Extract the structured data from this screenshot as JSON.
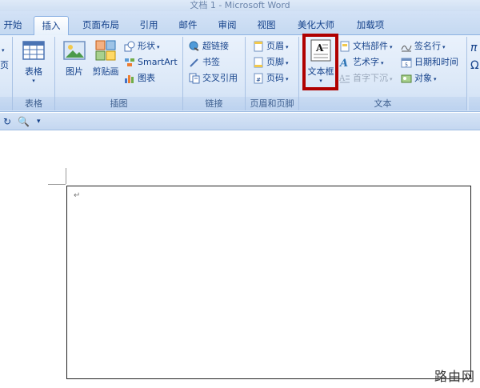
{
  "window": {
    "title": "文档 1 - Microsoft Word"
  },
  "tabs": [
    {
      "label": "开始"
    },
    {
      "label": "插入"
    },
    {
      "label": "页面布局"
    },
    {
      "label": "引用"
    },
    {
      "label": "邮件"
    },
    {
      "label": "审阅"
    },
    {
      "label": "视图"
    },
    {
      "label": "美化大师"
    },
    {
      "label": "加载项"
    }
  ],
  "active_tab": "插入",
  "ribbon": {
    "cut_left": {
      "label": "页"
    },
    "tables": {
      "group_label": "表格",
      "table_button": "表格"
    },
    "illustrations": {
      "group_label": "插图",
      "picture": "图片",
      "clipart": "剪贴画",
      "shapes": "形状",
      "smartart": "SmartArt",
      "chart": "图表"
    },
    "links": {
      "group_label": "链接",
      "hyperlink": "超链接",
      "bookmark": "书签",
      "crossref": "交叉引用"
    },
    "header_footer": {
      "group_label": "页眉和页脚",
      "header": "页眉",
      "footer": "页脚",
      "page_number": "页码"
    },
    "text": {
      "group_label": "文本",
      "textbox": "文本框",
      "quickparts": "文档部件",
      "wordart": "艺术字",
      "dropcap": "首字下沉",
      "signature": "签名行",
      "datetime": "日期和时间",
      "object": "对象"
    }
  },
  "qat": {
    "redo_icon": "redo-icon",
    "preview_icon": "print-preview-icon",
    "customize": "▾"
  },
  "document": {
    "paragraph_mark": "↵"
  },
  "watermark": "路由网",
  "colors": {
    "accent": "#15428b",
    "highlight": "#b00000",
    "ribbon": "#dde9f8"
  }
}
